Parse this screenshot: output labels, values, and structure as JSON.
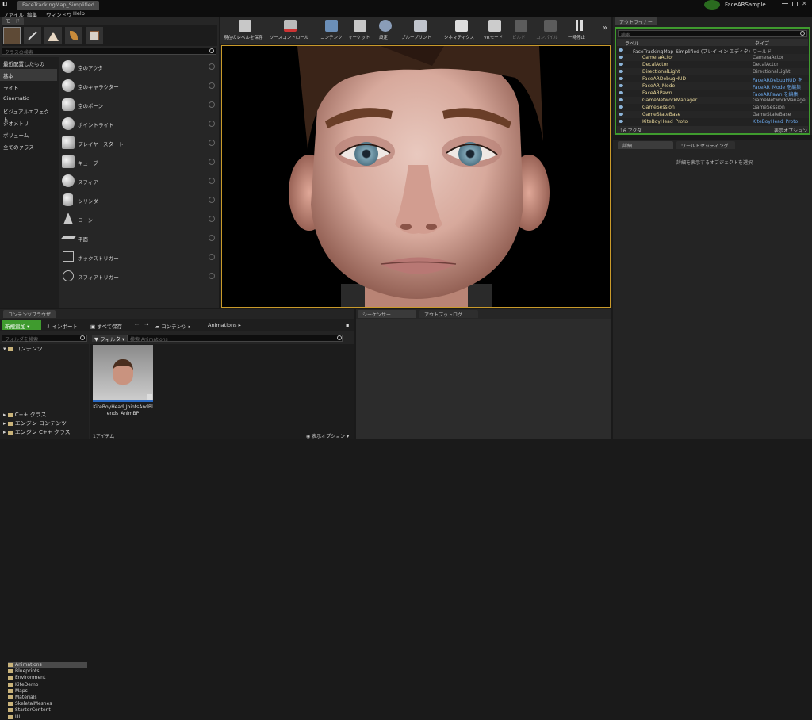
{
  "window": {
    "app_tab": "FaceTrackingMap_Simplified",
    "project_name": "FaceARSample"
  },
  "menu": [
    "ファイル",
    "編集",
    "ウィンドウ",
    "Help"
  ],
  "modes": {
    "tab": "モード",
    "search_placeholder": "クラスの検索",
    "categories": [
      "最近配置したもの",
      "基本",
      "ライト",
      "Cinematic",
      "ビジュアルエフェクト",
      "ジオメトリ",
      "ボリューム",
      "全てのクラス"
    ],
    "selected_category": "基本",
    "items": [
      "空のアクタ",
      "空のキャラクター",
      "空のポーン",
      "ポイントライト",
      "プレイヤースタート",
      "キューブ",
      "スフィア",
      "シリンダー",
      "コーン",
      "平面",
      "ボックストリガー",
      "スフィアトリガー"
    ]
  },
  "toolbar": {
    "items": [
      "現在のレベルを保存",
      "ソースコントロール",
      "コンテンツ",
      "マーケット",
      "設定",
      "ブループリント",
      "シネマティクス",
      "VRモード",
      "ビルド",
      "コンパイル",
      "一時停止"
    ]
  },
  "outliner": {
    "tab": "アウトライナー",
    "search_placeholder": "検索",
    "col_label": "ラベル",
    "col_type": "タイプ",
    "rows": [
      {
        "label": "FaceTrackingMap_Simplified (プレイ イン エディタ)",
        "type": "ワールド",
        "link": false
      },
      {
        "label": "CameraActor",
        "type": "CameraActor",
        "link": false
      },
      {
        "label": "DecalActor",
        "type": "DecalActor",
        "link": false
      },
      {
        "label": "DirectionalLight",
        "type": "DirectionalLight",
        "link": false
      },
      {
        "label": "FaceARDebugHUD",
        "type": "FaceARDebugHUD を",
        "link": true
      },
      {
        "label": "FaceAR_Mode",
        "type": "FaceAR_Mode を編集",
        "link": true
      },
      {
        "label": "FaceARPawn",
        "type": "FaceARPawn を編集",
        "link": true
      },
      {
        "label": "GameNetworkManager",
        "type": "GameNetworkManager",
        "link": false
      },
      {
        "label": "GameSession",
        "type": "GameSession",
        "link": false
      },
      {
        "label": "GameStateBase",
        "type": "GameStateBase",
        "link": false
      },
      {
        "label": "KiteBoyHead_Proto",
        "type": "KiteBoyHead_Proto",
        "link": true
      }
    ],
    "count": "16 アクタ",
    "view_options": "表示オプション"
  },
  "details": {
    "tab1": "詳細",
    "tab2": "ワールドセッティング",
    "empty_text": "詳細を表示するオブジェクトを選択"
  },
  "content_browser": {
    "tab": "コンテンツブラウザ",
    "add_new": "新規追加",
    "import": "インポート",
    "save_all": "すべて保存",
    "path": [
      "コンテンツ",
      "Animations"
    ],
    "folder_search": "フォルダを検索",
    "filter": "フィルタ",
    "asset_search": "検索 Animations",
    "root": "コンテンツ",
    "folders": [
      "Animations",
      "Blueprints",
      "Environment",
      "KiteDemo",
      "Maps",
      "Materials",
      "SkeletalMeshes",
      "StarterContent",
      "UI"
    ],
    "selected_folder": "Animations",
    "extra_roots": [
      "C++ クラス",
      "エンジン コンテンツ",
      "エンジン C++ クラス"
    ],
    "asset_name": "KiteBoyHead_JointsAndBlends_AnimBP",
    "item_count": "1アイテム",
    "view_options": "表示オプション"
  },
  "bottom_tabs": {
    "sequencer": "シーケンサー",
    "output_log": "アウトプットログ"
  },
  "colors": {
    "accent_green": "#3f9b2e",
    "viewport_border": "#c99a2a",
    "link_blue": "#6aa6e8",
    "selection": "#4a4a4a"
  }
}
